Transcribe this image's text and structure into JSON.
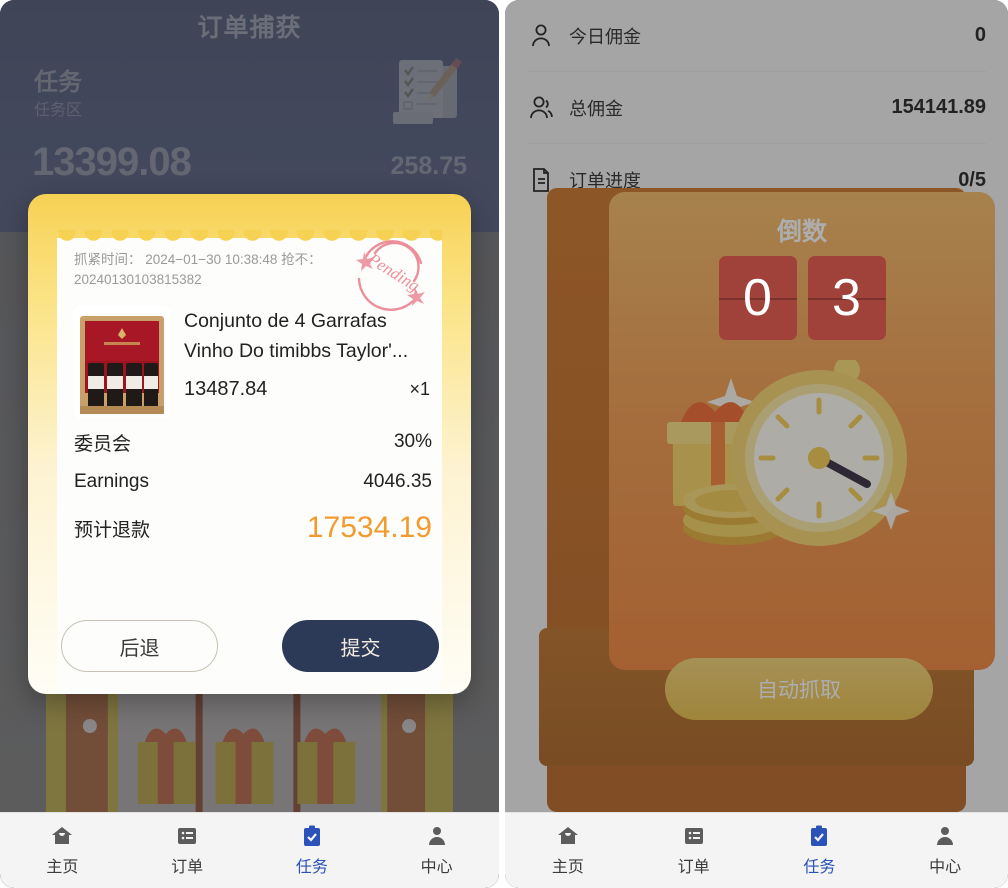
{
  "left_panel": {
    "header": {
      "title": "订单捕获",
      "task_label": "任务",
      "task_sub": "任务区",
      "balance": "13399.08",
      "secondary": "258.75",
      "icon": "clipboard-checklist-icon"
    },
    "modal": {
      "meta_line1": "抓紧时间： 2024−01−30 10:38:48 抢不：",
      "meta_line2": "20240130103815382",
      "stamp_text": "Pending",
      "product": {
        "name": "Conjunto de 4 Garrafas Vinho Do timibbs Taylor'...",
        "price": "13487.84",
        "qty": "×1",
        "image_alt": "wine-box-image"
      },
      "rows": [
        {
          "label": "委员会",
          "value": "30%"
        },
        {
          "label": "Earnings",
          "value": "4046.35"
        }
      ],
      "total": {
        "label": "预计退款",
        "value": "17534.19"
      },
      "back_button": "后退",
      "submit_button": "提交"
    }
  },
  "right_panel": {
    "stats": [
      {
        "icon": "person-icon",
        "label": "今日佣金",
        "value": "0"
      },
      {
        "icon": "people-icon",
        "label": "总佣金",
        "value": "154141.89"
      },
      {
        "icon": "document-icon",
        "label": "订单进度",
        "value": "0/5"
      }
    ],
    "countdown": {
      "title": "倒数",
      "digits": [
        "0",
        "3"
      ],
      "illustration": "stopwatch-gift-coins-icon"
    },
    "auto_grab_button": "自动抓取"
  },
  "bottom_nav": {
    "items": [
      {
        "label": "主页",
        "icon": "home-icon",
        "active": false
      },
      {
        "label": "订单",
        "icon": "list-icon",
        "active": false
      },
      {
        "label": "任务",
        "icon": "clipboard-check-icon",
        "active": true
      },
      {
        "label": "中心",
        "icon": "user-icon",
        "active": false
      }
    ]
  },
  "colors": {
    "header_navy": "#2c375f",
    "accent_orange": "#f29a2e",
    "nav_active": "#2a52b8",
    "flip_red": "#e8463a",
    "card_yellow": "#f7d154"
  }
}
